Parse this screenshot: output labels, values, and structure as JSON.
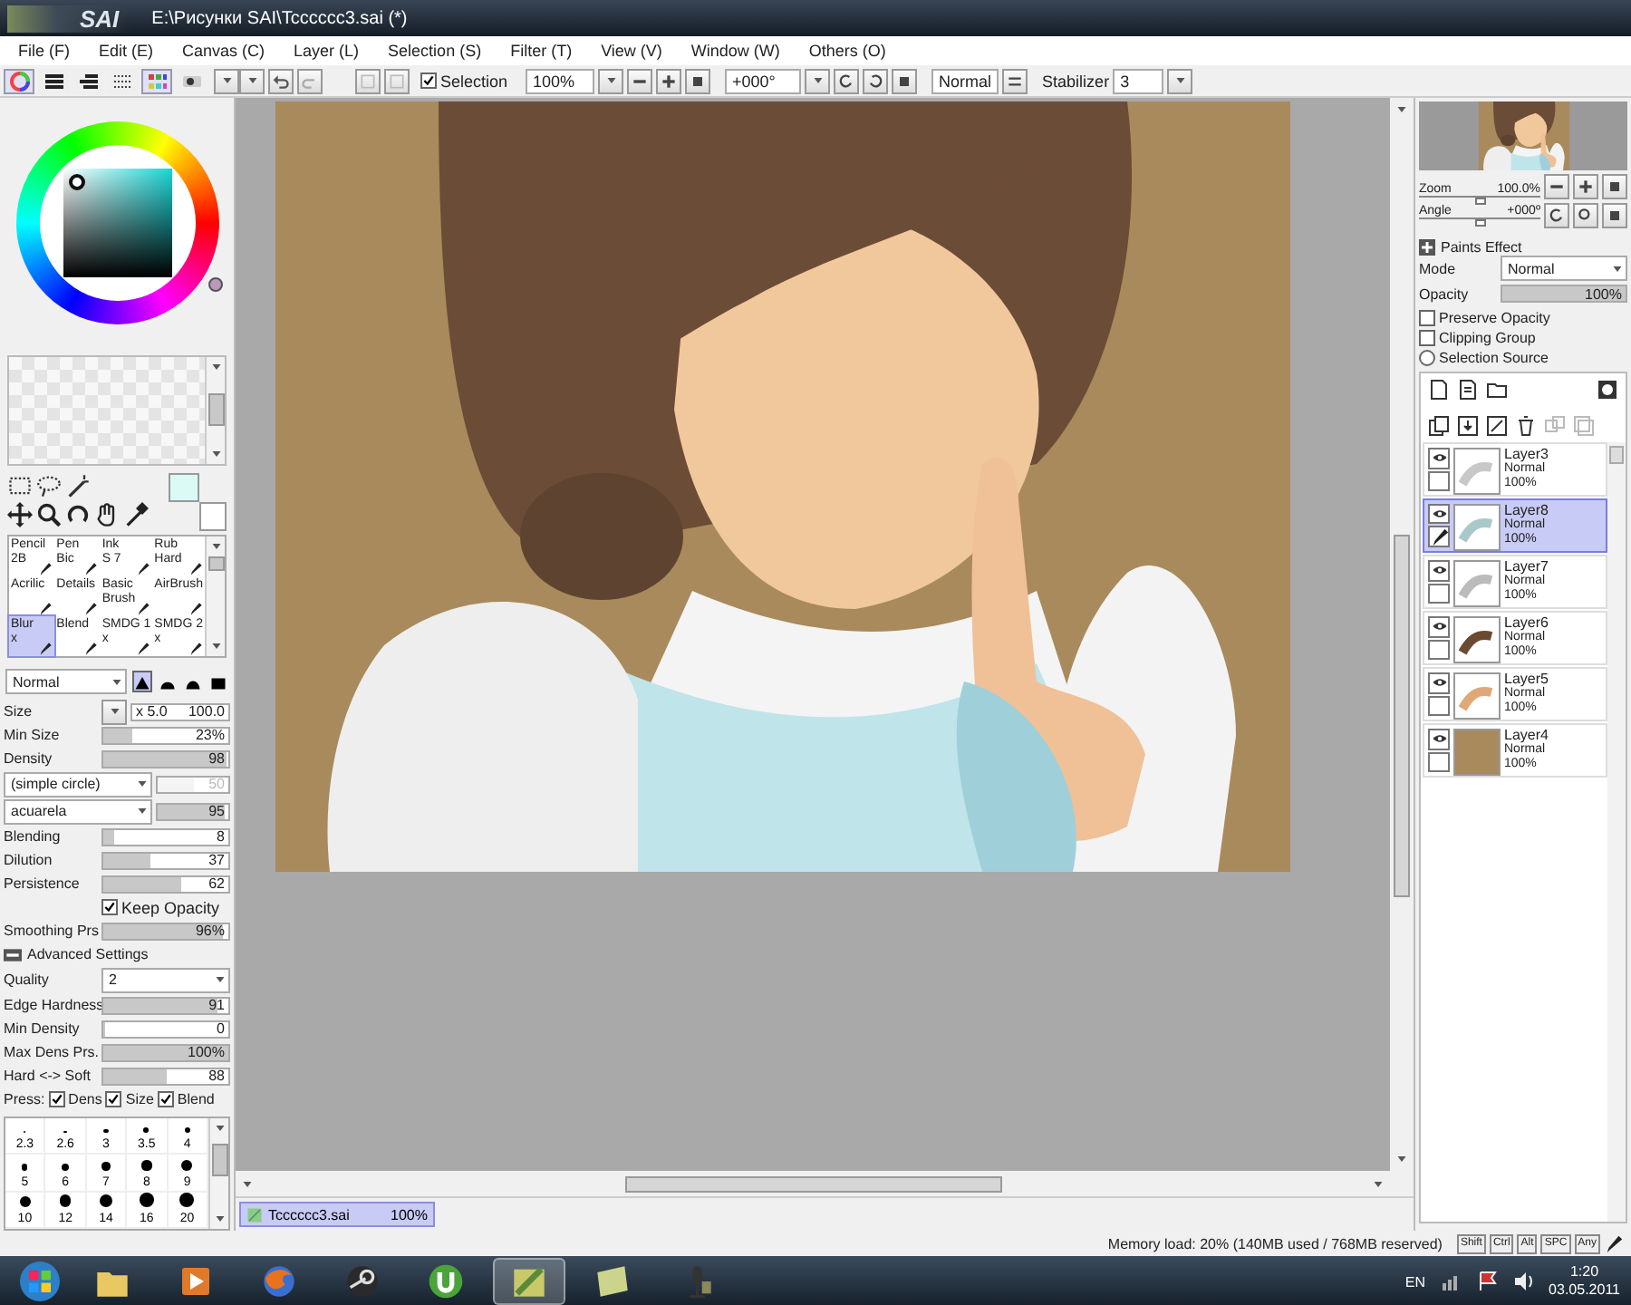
{
  "window": {
    "title": "E:\\Рисунки SAI\\Tcccccc3.sai (*)",
    "logo": "SAI"
  },
  "menu": [
    {
      "label": "File (F)"
    },
    {
      "label": "Edit (E)"
    },
    {
      "label": "Canvas (C)"
    },
    {
      "label": "Layer (L)"
    },
    {
      "label": "Selection (S)"
    },
    {
      "label": "Filter (T)"
    },
    {
      "label": "View (V)"
    },
    {
      "label": "Window (W)"
    },
    {
      "label": "Others (O)"
    }
  ],
  "toolbar": {
    "selection": {
      "label": "Selection",
      "checked": true
    },
    "zoom": "100%",
    "angle": "+000°",
    "blend": "Normal",
    "stabilizer": {
      "label": "Stabilizer",
      "value": "3"
    }
  },
  "color_modes": [
    {
      "kind": "wheel",
      "selected": true
    },
    {
      "kind": "rgb",
      "selected": false
    },
    {
      "kind": "hsv",
      "selected": false
    },
    {
      "kind": "mixer",
      "selected": false
    },
    {
      "kind": "swatches",
      "selected": true
    },
    {
      "kind": "scratch",
      "selected": false
    }
  ],
  "brushes": [
    {
      "name": "Pencil",
      "sub": "2B",
      "selected": false
    },
    {
      "name": "Pen",
      "sub": "Bic",
      "selected": false
    },
    {
      "name": "Ink",
      "sub": "S 7",
      "selected": false
    },
    {
      "name": "Rub",
      "sub": "Hard",
      "selected": false
    },
    {
      "name": "Acrilic",
      "selected": false
    },
    {
      "name": "Details",
      "selected": false
    },
    {
      "name": "Basic",
      "sub": "Brush",
      "selected": false
    },
    {
      "name": "AirBrush",
      "selected": false
    },
    {
      "name": "Blur",
      "sub": "x",
      "selected": true
    },
    {
      "name": "Blend",
      "selected": false
    },
    {
      "name": "SMDG 1",
      "sub": "x",
      "selected": false
    },
    {
      "name": "SMDG 2",
      "sub": "x",
      "selected": false
    }
  ],
  "blend_mode": "Normal",
  "tip_shapes": [
    {
      "selected": true
    },
    {
      "selected": false
    },
    {
      "selected": false
    },
    {
      "selected": false
    }
  ],
  "settings": [
    {
      "kind": "size",
      "label": "Size",
      "multiplier": "x 5.0",
      "reading": "100.0",
      "level": 0
    },
    {
      "kind": "slider",
      "label": "Min Size",
      "reading": "23%",
      "level": 0.23
    },
    {
      "kind": "slider",
      "label": "Density",
      "reading": "98",
      "level": 0.98
    },
    {
      "kind": "dropdown",
      "value": "(simple circle)",
      "reading": "50",
      "disabled": true,
      "level": 0.5
    },
    {
      "kind": "dropdown",
      "value": "acuarela",
      "reading": "95",
      "disabled": false,
      "level": 0.95
    },
    {
      "kind": "slider",
      "label": "Blending",
      "reading": "8",
      "level": 0.08
    },
    {
      "kind": "slider",
      "label": "Dilution",
      "reading": "37",
      "level": 0.37
    },
    {
      "kind": "slider",
      "label": "Persistence",
      "reading": "62",
      "level": 0.62
    },
    {
      "kind": "check",
      "label": "Keep Opacity",
      "checked": true
    },
    {
      "kind": "slider",
      "label": "Smoothing Prs",
      "reading": "96%",
      "level": 0.96
    },
    {
      "kind": "section",
      "label": "Advanced Settings",
      "expanded": true
    },
    {
      "kind": "select",
      "label": "Quality",
      "value": "2"
    },
    {
      "kind": "slider",
      "label": "Edge Hardness",
      "reading": "91",
      "level": 0.91
    },
    {
      "kind": "slider",
      "label": "Min Density",
      "reading": "0",
      "level": 0
    },
    {
      "kind": "slider",
      "label": "Max Dens Prs.",
      "reading": "100%",
      "level": 1
    },
    {
      "kind": "slider",
      "label": "Hard <-> Soft",
      "reading": "88",
      "level": 0.5
    },
    {
      "kind": "press",
      "label": "Press:",
      "options": [
        {
          "label": "Dens",
          "checked": true
        },
        {
          "label": "Size",
          "checked": true
        },
        {
          "label": "Blend",
          "checked": true
        }
      ]
    }
  ],
  "tip_sizes": [
    "2.3",
    "2.6",
    "3",
    "3.5",
    "4",
    "5",
    "6",
    "7",
    "8",
    "9",
    "10",
    "12",
    "14",
    "16",
    "20"
  ],
  "document_tab": {
    "name": "Tcccccc3.sai",
    "zoom": "100%",
    "selected": true
  },
  "navigator": {
    "zoom_label": "Zoom",
    "zoom": "100.0%",
    "zoom_level": {
      "level": 0.5
    },
    "angle_label": "Angle",
    "angle": "+000º",
    "angle_level": {
      "level": 0.5
    }
  },
  "layer_props": {
    "paints_effect": "Paints Effect",
    "mode_label": "Mode",
    "mode": "Normal",
    "opacity_label": "Opacity",
    "opacity": {
      "reading": "100%",
      "level": 1
    },
    "options": [
      {
        "kind": "check",
        "label": "Preserve Opacity",
        "checked": false
      },
      {
        "kind": "check",
        "label": "Clipping Group",
        "checked": false
      },
      {
        "kind": "radio",
        "label": "Selection Source",
        "checked": false
      }
    ]
  },
  "layers": [
    {
      "name": "Layer3",
      "mode": "Normal",
      "opacity": "100%",
      "visible": true,
      "editing": false,
      "selected": false,
      "kind": "sketch",
      "color": "#c8c8c8"
    },
    {
      "name": "Layer8",
      "mode": "Normal",
      "opacity": "100%",
      "visible": true,
      "editing": true,
      "selected": true,
      "kind": "sketch",
      "color": "#a9c9c9"
    },
    {
      "name": "Layer7",
      "mode": "Normal",
      "opacity": "100%",
      "visible": true,
      "editing": false,
      "selected": false,
      "kind": "sketch",
      "color": "#bbbbbb"
    },
    {
      "name": "Layer6",
      "mode": "Normal",
      "opacity": "100%",
      "visible": true,
      "editing": false,
      "selected": false,
      "kind": "sketch",
      "color": "#6b4a33"
    },
    {
      "name": "Layer5",
      "mode": "Normal",
      "opacity": "100%",
      "visible": true,
      "editing": false,
      "selected": false,
      "kind": "sketch",
      "color": "#e0a878"
    },
    {
      "name": "Layer4",
      "mode": "Normal",
      "opacity": "100%",
      "visible": true,
      "editing": false,
      "selected": false,
      "kind": "fill",
      "color": "#a88a5c"
    }
  ],
  "status": {
    "memory": "Memory load: 20% (140MB used / 768MB reserved)",
    "keys": [
      {
        "label": "Shift"
      },
      {
        "label": "Ctrl"
      },
      {
        "label": "Alt"
      },
      {
        "label": "SPC"
      },
      {
        "label": "Any"
      }
    ]
  },
  "taskbar": {
    "apps": [
      {
        "kind": "folder",
        "selected": false
      },
      {
        "kind": "media",
        "selected": false
      },
      {
        "kind": "browser",
        "selected": false
      },
      {
        "kind": "steam",
        "selected": false
      },
      {
        "kind": "torrent",
        "selected": false
      },
      {
        "kind": "paint",
        "selected": true
      },
      {
        "kind": "notes",
        "selected": false
      },
      {
        "kind": "tool",
        "selected": false
      }
    ],
    "language": "EN",
    "time": "1:20",
    "date": "03.05.2011"
  }
}
